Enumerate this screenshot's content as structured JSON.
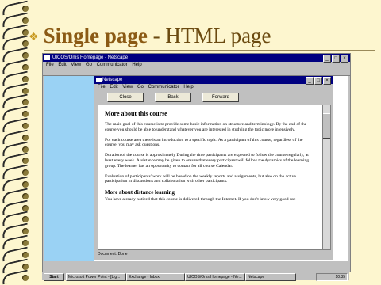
{
  "slide": {
    "title_bold": "Single page",
    "title_rest": " - HTML page"
  },
  "outer_window": {
    "title": "UICOS/Oms Homepage - Netscape",
    "menu": [
      "File",
      "Edit",
      "View",
      "Go",
      "Communicator",
      "Help"
    ]
  },
  "inner_window": {
    "title": "Netscape",
    "menu": [
      "File",
      "Edit",
      "View",
      "Go",
      "Communicator",
      "Help"
    ],
    "buttons": [
      "Close",
      "Back",
      "Forward"
    ],
    "status": "Document: Done"
  },
  "document": {
    "heading": "More about this course",
    "paragraphs": [
      "The main goal of this course is to provide some basic information on structure and terminology. By the end of the course you should be able to understand whatever you are interested in studying the topic more intensively.",
      "For each course area there is an introduction to a specific topic. As a participant of this course, regardless of the course, you may ask questions.",
      "Duration of the course is approximately During the time participants are expected to follow the course regularly, at least every week. Assistance may be given to ensure that every participant will follow the dynamics of the learning group. The learner has an opportunity to contact for all course Calendar.",
      "Evaluation of participants' work will be based on the weekly reports and assignments, but also on the active participation in discussions and collaboration with other participants."
    ],
    "subheading": "More about distance learning",
    "last_para": "You have already noticed that this course is delivered through the Internet. If you don't know very good use"
  },
  "taskbar": {
    "start": "Start",
    "items": [
      "Microsoft Power Point - [Lig...",
      "Exchange - Inbox",
      "UICOS/Oms Homepage - Ne...",
      "Netscape"
    ],
    "clock": "10:35"
  }
}
